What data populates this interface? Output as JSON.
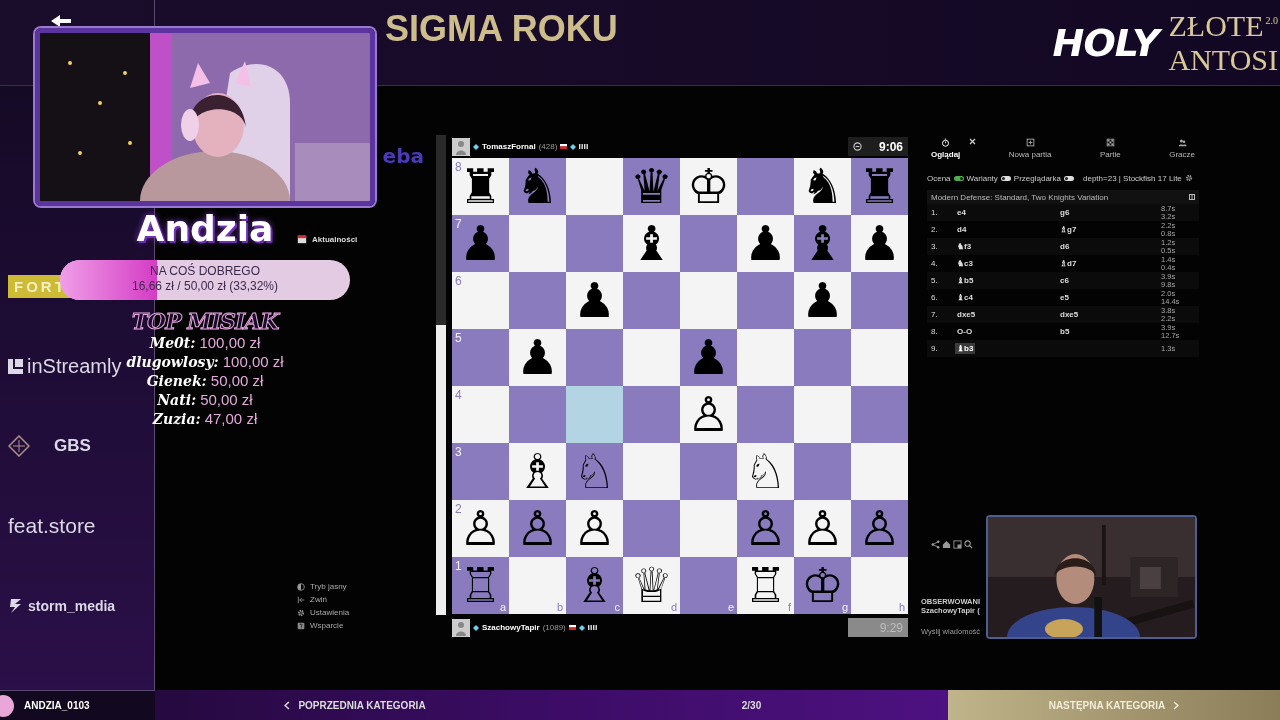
{
  "header": {
    "title": "SIGMA ROKU",
    "logo": {
      "brand": "HOLY",
      "line_1": "ZŁOTE",
      "version": "2.0",
      "line_2": "ANTOSI"
    }
  },
  "sponsors": [
    {
      "name": "FORT",
      "kind": "banner"
    },
    {
      "name": "inStreamly",
      "kind": "square"
    },
    {
      "name": "GBS",
      "kind": "diamond"
    },
    {
      "name": "feat.store",
      "kind": "plain"
    },
    {
      "name": "storm_media",
      "kind": "storm"
    }
  ],
  "streamer": {
    "name": "Andzia"
  },
  "donation_goal": {
    "title": "NA COŚ DOBREGO",
    "progress": "16,66 zł / 50,00 zł (33,32%)",
    "level": 0.3332
  },
  "top_donors": {
    "title": "TOP MISIAK",
    "donors": [
      {
        "name": "Me0t:",
        "amount": "100,00 zł"
      },
      {
        "name": "dlugowlosy:",
        "amount": "100,00 zł"
      },
      {
        "name": "Gienek:",
        "amount": "50,00 zł"
      },
      {
        "name": "Nati:",
        "amount": "50,00 zł"
      },
      {
        "name": "Zuzia:",
        "amount": "47,00 zł"
      }
    ]
  },
  "app_sidebar": {
    "logo_fragment": "eba",
    "items": [
      {
        "label": "Aktualności",
        "kind": "calendar"
      }
    ],
    "footer_items": [
      {
        "label": "Tryb jasny",
        "kind": "contrast"
      },
      {
        "label": "Zwiń",
        "kind": "collapse"
      },
      {
        "label": "Ustawienia",
        "kind": "gear"
      },
      {
        "label": "Wsparcie",
        "kind": "help"
      }
    ]
  },
  "players": [
    {
      "name": "TomaszFornal",
      "rating": "(428)",
      "clock": "9:06",
      "active": true
    },
    {
      "name": "SzachowyTapir",
      "rating": "(1089)",
      "clock": "9:29",
      "active": false
    }
  ],
  "board": {
    "files": [
      "a",
      "b",
      "c",
      "d",
      "e",
      "f",
      "g",
      "h"
    ],
    "ranks": [
      {
        "label": "8",
        "squares": [
          {
            "glyph": "♜",
            "highlighted": false
          },
          {
            "glyph": "♞",
            "highlighted": false
          },
          {
            "highlighted": false
          },
          {
            "glyph": "♛",
            "highlighted": false
          },
          {
            "glyph": "♔",
            "highlighted": false
          },
          {
            "highlighted": false
          },
          {
            "glyph": "♞",
            "highlighted": false
          },
          {
            "glyph": "♜",
            "highlighted": false
          }
        ]
      },
      {
        "label": "7",
        "squares": [
          {
            "glyph": "♟",
            "highlighted": false
          },
          {
            "highlighted": false
          },
          {
            "highlighted": false
          },
          {
            "glyph": "♝",
            "highlighted": false
          },
          {
            "highlighted": false
          },
          {
            "glyph": "♟",
            "highlighted": false
          },
          {
            "glyph": "♝",
            "highlighted": false
          },
          {
            "glyph": "♟",
            "highlighted": false
          }
        ]
      },
      {
        "label": "6",
        "squares": [
          {
            "highlighted": false
          },
          {
            "highlighted": false
          },
          {
            "glyph": "♟",
            "highlighted": false
          },
          {
            "highlighted": false
          },
          {
            "highlighted": false
          },
          {
            "highlighted": false
          },
          {
            "glyph": "♟",
            "highlighted": false
          },
          {
            "highlighted": false
          }
        ]
      },
      {
        "label": "5",
        "squares": [
          {
            "highlighted": false
          },
          {
            "glyph": "♟",
            "highlighted": false
          },
          {
            "highlighted": false
          },
          {
            "highlighted": false
          },
          {
            "glyph": "♟",
            "highlighted": false
          },
          {
            "highlighted": false
          },
          {
            "highlighted": false
          },
          {
            "highlighted": false
          }
        ]
      },
      {
        "label": "4",
        "squares": [
          {
            "highlighted": false
          },
          {
            "highlighted": false
          },
          {
            "highlighted": true
          },
          {
            "highlighted": false
          },
          {
            "glyph": "♙",
            "highlighted": false
          },
          {
            "highlighted": false
          },
          {
            "highlighted": false
          },
          {
            "highlighted": false
          }
        ]
      },
      {
        "label": "3",
        "squares": [
          {
            "highlighted": false
          },
          {
            "glyph": "♗",
            "highlighted": false
          },
          {
            "glyph": "♘",
            "highlighted": false
          },
          {
            "highlighted": false
          },
          {
            "highlighted": false
          },
          {
            "glyph": "♘",
            "highlighted": false
          },
          {
            "highlighted": false
          },
          {
            "highlighted": false
          }
        ]
      },
      {
        "label": "2",
        "squares": [
          {
            "glyph": "♙",
            "highlighted": false
          },
          {
            "glyph": "♙",
            "highlighted": false
          },
          {
            "glyph": "♙",
            "highlighted": false
          },
          {
            "highlighted": false
          },
          {
            "highlighted": false
          },
          {
            "glyph": "♙",
            "highlighted": false
          },
          {
            "glyph": "♙",
            "highlighted": false
          },
          {
            "glyph": "♙",
            "highlighted": false
          }
        ]
      },
      {
        "label": "1",
        "squares": [
          {
            "glyph": "♖",
            "highlighted": false
          },
          {
            "highlighted": false
          },
          {
            "glyph": "♗",
            "highlighted": false
          },
          {
            "glyph": "♕",
            "highlighted": false
          },
          {
            "highlighted": false
          },
          {
            "glyph": "♖",
            "highlighted": false
          },
          {
            "glyph": "♔",
            "highlighted": false
          },
          {
            "highlighted": false
          }
        ]
      }
    ]
  },
  "analysis": {
    "tabs": [
      {
        "label": "Oglądaj",
        "kind": "watch",
        "selected": true
      },
      {
        "label": "Nowa partia",
        "kind": "new",
        "selected": false
      },
      {
        "label": "Partie",
        "kind": "games",
        "selected": false
      },
      {
        "label": "Gracze",
        "kind": "players",
        "selected": false
      }
    ],
    "toggles": [
      {
        "label": "Ocena",
        "on": true
      },
      {
        "label": "Warianty",
        "on": false
      },
      {
        "label": "Przeglądarka",
        "on": false
      }
    ],
    "engine": "depth=23 | Stockfish 17 Lite",
    "opening": "Modern Defense: Standard, Two Knights Variation",
    "moves": [
      {
        "number": "1.",
        "white": "e4",
        "black": "g6",
        "white_time": "8.7s",
        "black_time": "3.2s",
        "selected": false
      },
      {
        "number": "2.",
        "white": "d4",
        "black": "♗g7",
        "white_time": "2.2s",
        "black_time": "0.8s",
        "selected": false
      },
      {
        "number": "3.",
        "white": "♞f3",
        "black": "d6",
        "white_time": "1.2s",
        "black_time": "0.5s",
        "selected": false
      },
      {
        "number": "4.",
        "white": "♞c3",
        "black": "♗d7",
        "white_time": "1.4s",
        "black_time": "0.4s",
        "selected": false
      },
      {
        "number": "5.",
        "white": "♝b5",
        "black": "c6",
        "white_time": "3.9s",
        "black_time": "9.8s",
        "selected": false
      },
      {
        "number": "6.",
        "white": "♝c4",
        "black": "e5",
        "white_time": "2.0s",
        "black_time": "14.4s",
        "selected": false
      },
      {
        "number": "7.",
        "white": "dxe5",
        "black": "dxe5",
        "white_time": "3.8s",
        "black_time": "2.2s",
        "selected": false
      },
      {
        "number": "8.",
        "white": "O-O",
        "black": "b5",
        "white_time": "3.9s",
        "black_time": "12.7s",
        "selected": false
      },
      {
        "number": "9.",
        "white": "♝b3",
        "white_time": "1.3s",
        "selected": true
      }
    ]
  },
  "followed": {
    "title": "OBSERWOWANI",
    "player": "SzachowyTapir (",
    "message_placeholder": "Wyślij wiadomość"
  },
  "footer": {
    "user": "ANDZIA_0103",
    "previous": "POPRZEDNIA KATEGORIA",
    "page": "2/30",
    "next": "NASTĘPNA KATEGORIA"
  }
}
